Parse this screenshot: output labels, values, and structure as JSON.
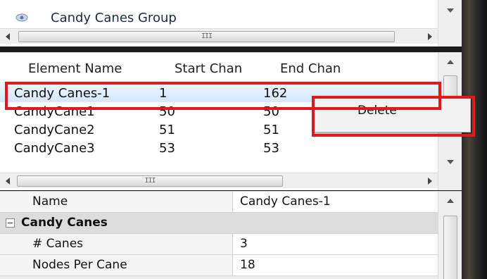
{
  "group_panel": {
    "group_name": "Candy Canes Group",
    "icon": "eye-icon"
  },
  "element_table": {
    "columns": [
      "Element Name",
      "Start Chan",
      "End Chan"
    ],
    "rows": [
      {
        "name": "Candy Canes-1",
        "start": "1",
        "end": "162",
        "selected": true
      },
      {
        "name": "CandyCane1",
        "start": "50",
        "end": "50"
      },
      {
        "name": "CandyCane2",
        "start": "51",
        "end": "51"
      },
      {
        "name": "CandyCane3",
        "start": "53",
        "end": "53"
      }
    ]
  },
  "context_menu": {
    "items": [
      "Delete"
    ]
  },
  "properties": {
    "header": {
      "name": "Name",
      "value": "Candy Canes-1"
    },
    "category": "Candy Canes",
    "rows": [
      {
        "name": "# Canes",
        "value": "3"
      },
      {
        "name": "Nodes Per Cane",
        "value": "18"
      }
    ]
  },
  "colors": {
    "highlight": "#e0191e",
    "selection": "#d4e7fb"
  }
}
